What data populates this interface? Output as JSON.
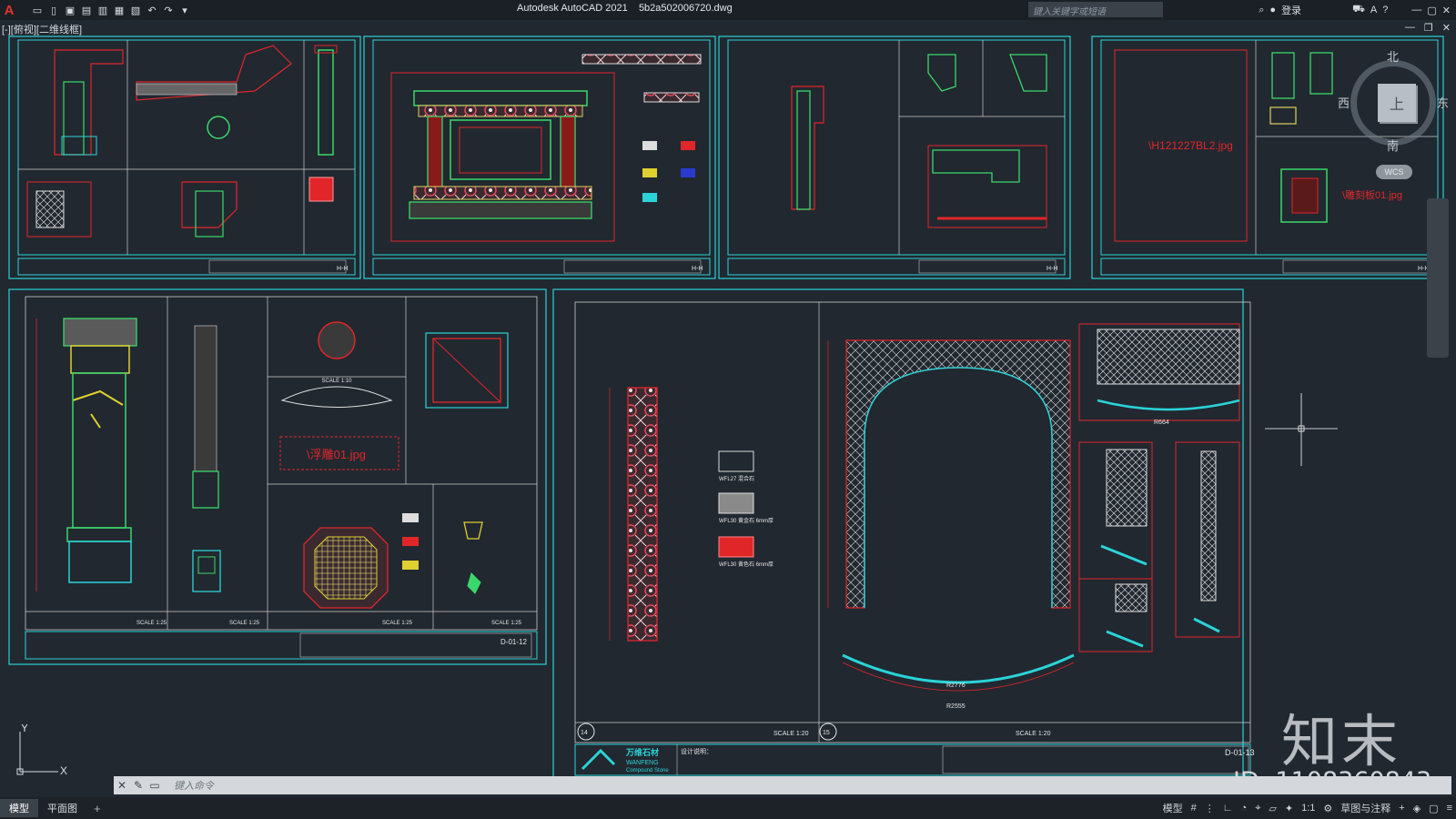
{
  "titlebar": {
    "app_title": "Autodesk AutoCAD 2021",
    "file_name": "5b2a502006720.dwg",
    "search_placeholder": "键入关键字或短语",
    "login_label": "登录"
  },
  "viewport": {
    "label": "[-][俯视][二维线框]"
  },
  "viewcube": {
    "north": "北",
    "south": "南",
    "east": "东",
    "west": "西",
    "face": "上",
    "wcs": "WCS"
  },
  "drawing": {
    "sheets_top": [
      {
        "num": "H-H"
      },
      {
        "num": "H-H"
      },
      {
        "num": "H-H"
      },
      {
        "num": "H-H"
      }
    ],
    "bottom_left": {
      "image_ref": "\\浮雕01.jpg",
      "scales": [
        "SCALE 1:10",
        "SCALE 1:25",
        "SCALE 1:5",
        "SCALE 1:25",
        "SCALE 1:25",
        "SCALE 1:15",
        "SCALE 1:25"
      ],
      "sheet_no": "D-01-12"
    },
    "top_right_ref1": "\\H121227BL2.jpg",
    "top_right_ref2": "\\雕刻板01.jpg",
    "bottom_right": {
      "dims": [
        "R2776",
        "R2555",
        "R664"
      ],
      "scales": [
        "SCALE 1:20",
        "SCALE 1:20"
      ],
      "sheet_no": "D-01-13",
      "brand_cn": "万维石材",
      "brand_en": "WANFENG",
      "brand_sub": "Compound Stone",
      "legend": [
        "WFL27 混合石",
        "WFL30 黄金石 6mm厚",
        "WFL30 黄色石 6mm厚"
      ],
      "section_labels": [
        "14",
        "15"
      ],
      "design_note": "设计说明："
    }
  },
  "watermark": {
    "brand": "知末",
    "id": "ID: 1108360843"
  },
  "ucs": {
    "x": "X",
    "y": "Y"
  },
  "command": {
    "placeholder": "键入命令"
  },
  "statusbar": {
    "tabs": [
      "模型",
      "平面图"
    ],
    "model_label": "模型",
    "scale": "1:1",
    "annotation": "草图与注释"
  }
}
